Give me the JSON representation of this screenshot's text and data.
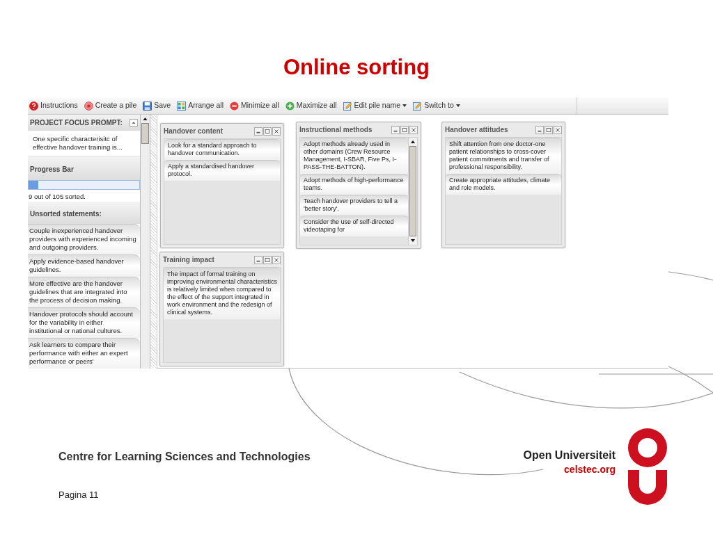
{
  "slide": {
    "title": "Online sorting",
    "organisation": "Centre for Learning Sciences and Technologies",
    "brand": "Open Universiteit",
    "website": "celstec.org",
    "page": "Pagina 11"
  },
  "toolbar": [
    {
      "kind": "help",
      "label": "Instructions",
      "dropdown": false
    },
    {
      "kind": "create",
      "label": "Create a pile",
      "dropdown": false
    },
    {
      "kind": "save",
      "label": "Save",
      "dropdown": false
    },
    {
      "kind": "arrange",
      "label": "Arrange all",
      "dropdown": false
    },
    {
      "kind": "minimize",
      "label": "Minimize all",
      "dropdown": false
    },
    {
      "kind": "maximize",
      "label": "Maximize all",
      "dropdown": false
    },
    {
      "kind": "edit",
      "label": "Edit pile name",
      "dropdown": true
    },
    {
      "kind": "edit",
      "label": "Switch to",
      "dropdown": true
    }
  ],
  "sidebar": {
    "prompt_heading": "PROJECT FOCUS PROMPT:",
    "prompt": "One specific characterisitc of effective handover training is...",
    "progress_heading": "Progress Bar",
    "progress": {
      "level": 0.09,
      "reading": "9 out of 105 sorted."
    },
    "unsorted_heading": "Unsorted statements:",
    "statements": [
      "Couple inexperienced handover providers with experienced incoming and outgoing providers.",
      "Apply evidence-based handover guidelines.",
      "More effective are the handover guidelines that are integrated into the process of decision making.",
      "Handover protocols should account for the variability in either institutional or national cultures.",
      "Ask learners to compare their performance with either an expert performance or peers'"
    ]
  },
  "piles": [
    {
      "title": "Handover content",
      "scrollbar": false,
      "statements": [
        "Look for a standard approach to handover communication.",
        "Apply a standardised handover protocol."
      ]
    },
    {
      "title": "Training impact",
      "scrollbar": false,
      "statements": [
        "The impact of formal training on improving environmental characteristics is relatively limited when compared to the effect of the support integrated in work environment and the redesign of clinical systems."
      ]
    },
    {
      "title": "Instructional methods",
      "scrollbar": true,
      "statements": [
        "Adopt methods already used in other domains (Crew Resource Management, I-SBAR, Five Ps, I-PASS-THE-BATTON).",
        "Adopt methods of high-performance teams.",
        "Teach handover providers to tell a 'better story'.",
        "Consider the use of self-directed videotaping for"
      ]
    },
    {
      "title": "Handover attitudes",
      "scrollbar": false,
      "statements": [
        "Shift attention from one doctor-one patient relationships to cross-cover patient commitments and transfer of professional responsibility.",
        "Create appropriate attitudes, climate and role models."
      ]
    }
  ]
}
